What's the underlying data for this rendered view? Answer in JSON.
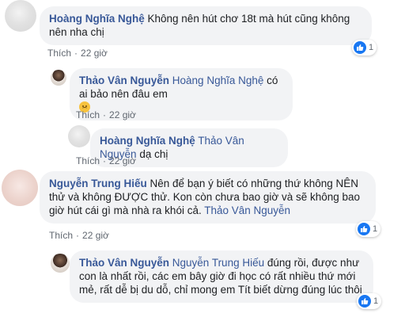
{
  "comments": [
    {
      "author": "Hoàng Nghĩa Nghệ",
      "text": "Không nên hút chơ 18t mà hút cũng không nên nha chị",
      "like_label": "Thích",
      "time": "22 giờ",
      "reaction_count": "1"
    },
    {
      "author": "Thảo Vân Nguyễn",
      "tag": "Hoàng Nghĩa Nghệ",
      "text": "có ai bảo nên đâu em",
      "emoji": "disappointed-emoji",
      "like_label": "Thích",
      "time": "22 giờ"
    },
    {
      "author": "Hoàng Nghĩa Nghệ",
      "tag": "Thảo Vân Nguyễn",
      "text": "dạ chị",
      "like_label": "Thích",
      "time": "22 giờ"
    },
    {
      "author": "Nguyễn Trung Hiếu",
      "text": "Nên để bạn ý biết có những thứ không NÊN thử và không ĐƯỢC thử. Kon còn chưa bao giờ và sẽ không bao giờ hút cái gì mà nhà ra khói cả.",
      "tag": "Thảo Vân Nguyễn",
      "like_label": "Thích",
      "time": "22 giờ",
      "reaction_count": "1"
    },
    {
      "author": "Thảo Vân Nguyễn",
      "tag": "Nguyễn Trung Hiếu",
      "text": "đúng rồi, được như con là nhất rồi, các em bây giờ đi học có rất nhiều thứ mới mẻ, rất dễ bị du dỗ, chỉ mong em Tít biết dừng đúng lúc thôi",
      "reaction_count": "1"
    }
  ],
  "colors": {
    "name": "#385898",
    "bubble": "#f2f3f5",
    "like_blue": "#1877f2"
  }
}
